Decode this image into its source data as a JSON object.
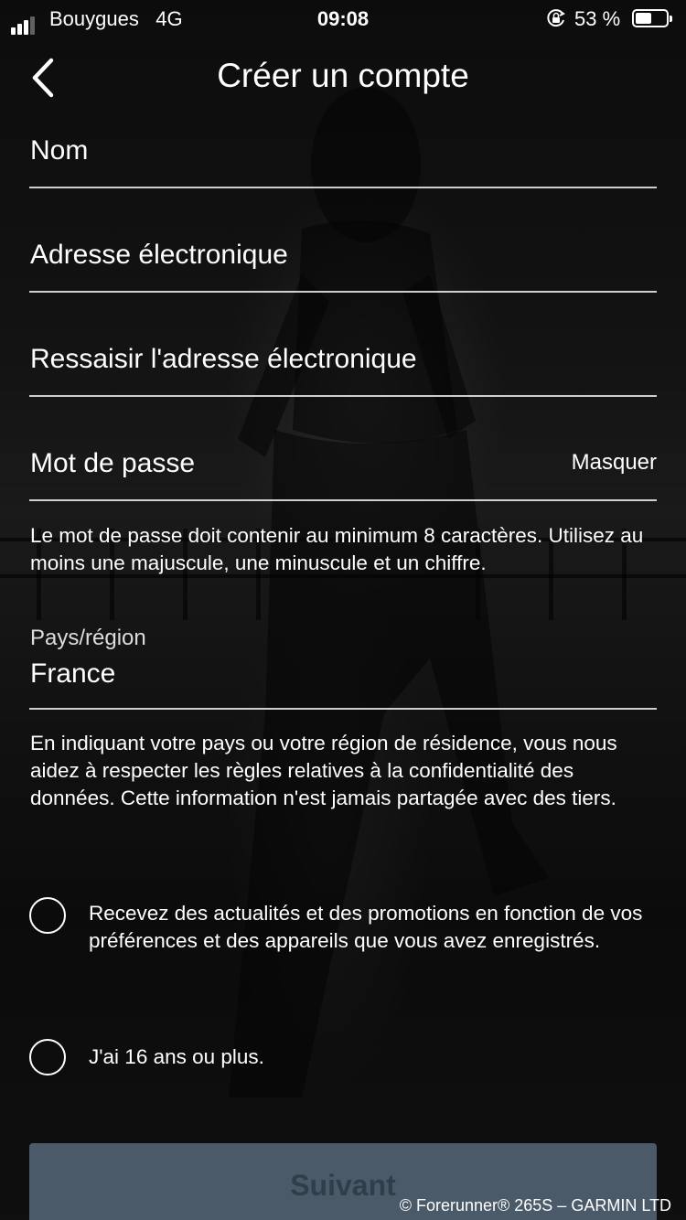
{
  "status_bar": {
    "carrier": "Bouygues",
    "network": "4G",
    "time": "09:08",
    "battery_percent": "53 %",
    "signal_bars_on": 3,
    "signal_bars_total": 4,
    "battery_level": 0.53
  },
  "header": {
    "title": "Créer un compte",
    "back_icon": "chevron-left-icon"
  },
  "form": {
    "name_placeholder": "Nom",
    "email_placeholder": "Adresse électronique",
    "email_confirm_placeholder": "Ressaisir l'adresse électronique",
    "password_placeholder": "Mot de passe",
    "password_toggle": "Masquer",
    "password_help": "Le mot de passe doit contenir au minimum 8 caractères. Utilisez au moins une majuscule, une minuscule et un chiffre.",
    "country_label": "Pays/région",
    "country_value": "France",
    "country_help": "En indiquant votre pays ou votre région de résidence, vous nous aidez à respecter les règles relatives à la confidentialité des données. Cette information n'est jamais partagée avec des tiers."
  },
  "options": [
    {
      "label": "Recevez des actualités et des promotions en fonction de vos préférences et des appareils que vous avez enregistrés.",
      "checked": false
    },
    {
      "label": "J'ai 16 ans ou plus.",
      "checked": false
    }
  ],
  "next_button": {
    "label": "Suivant"
  },
  "credit": "© Forerunner® 265S – GARMIN LTD",
  "colors": {
    "button_bg": "#4a5a69",
    "text": "#ffffff",
    "underline": "#cccccc"
  }
}
